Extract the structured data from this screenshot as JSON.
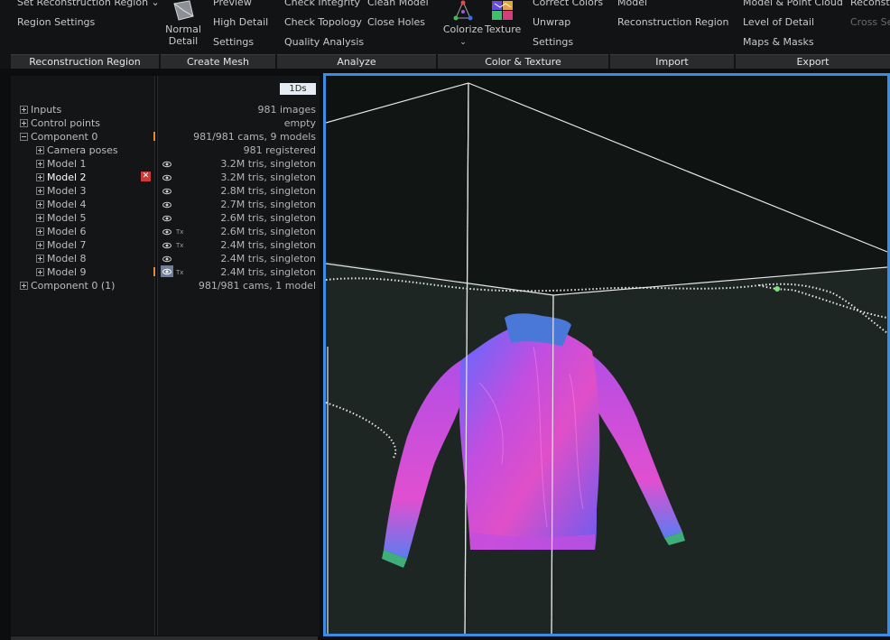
{
  "ribbon": {
    "groups": {
      "reconstruction_region": {
        "label": "Reconstruction Region",
        "items": [
          "Set Reconstruction Region",
          "Region Settings"
        ]
      },
      "create_mesh": {
        "label": "Create Mesh",
        "normal_detail": "Normal Detail",
        "items": [
          "Preview",
          "High Detail",
          "Settings"
        ]
      },
      "analyze": {
        "label": "Analyze",
        "items": [
          "Check Integrity",
          "Check Topology",
          "Quality Analysis",
          "Clean Model",
          "Close Holes"
        ]
      },
      "color_texture": {
        "label": "Color & Texture",
        "colorize": "Colorize",
        "texture": "Texture",
        "items": [
          "Correct Colors",
          "Unwrap",
          "Settings"
        ]
      },
      "import": {
        "label": "Import",
        "items": [
          "Model",
          "Reconstruction Region"
        ]
      },
      "export": {
        "label": "Export",
        "items": [
          "Model & Point Cloud",
          "Level of Detail",
          "Maps & Masks",
          "Reconstr",
          "Cross Se"
        ]
      }
    }
  },
  "panel": {
    "badge": "1Ds",
    "tree": [
      {
        "label": "Inputs",
        "value": "981 images"
      },
      {
        "label": "Control points",
        "value": "empty"
      },
      {
        "label": "Component 0",
        "value": "981/981 cams, 9 models"
      },
      {
        "label": "Camera poses",
        "value": "981 registered"
      },
      {
        "label": "Model 1",
        "value": "3.2M tris, singleton"
      },
      {
        "label": "Model 2",
        "value": "3.2M tris, singleton"
      },
      {
        "label": "Model 3",
        "value": "2.8M tris, singleton"
      },
      {
        "label": "Model 4",
        "value": "2.7M tris, singleton"
      },
      {
        "label": "Model 5",
        "value": "2.6M tris, singleton"
      },
      {
        "label": "Model 6",
        "value": "2.6M tris, singleton"
      },
      {
        "label": "Model 7",
        "value": "2.4M tris, singleton"
      },
      {
        "label": "Model 8",
        "value": "2.4M tris, singleton"
      },
      {
        "label": "Model 9",
        "value": "2.4M tris, singleton"
      },
      {
        "label": "Component 0 (1)",
        "value": "981/981 cams, 1 model"
      }
    ],
    "tx_label": "Tx",
    "close_glyph": "✕"
  },
  "colors": {
    "accent_blue": "#3c8ce6",
    "marker_orange": "#e08a3a",
    "marker_red": "#c83c3c"
  }
}
